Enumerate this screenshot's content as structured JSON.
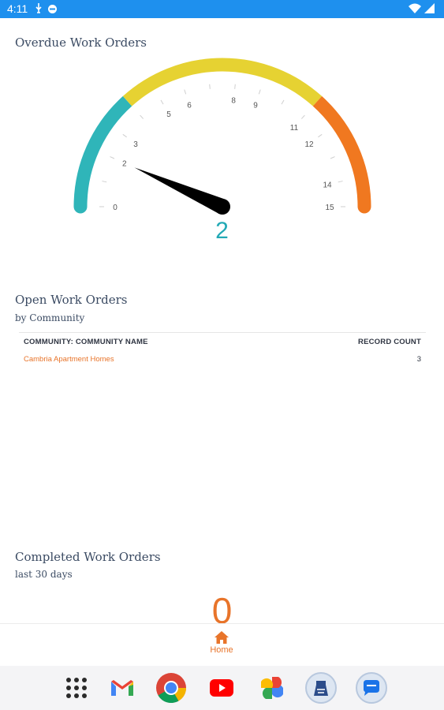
{
  "status_bar": {
    "time": "4:11",
    "left_icons": [
      "usb-icon",
      "sync-icon"
    ],
    "right_icons": [
      "wifi-icon",
      "signal-icon"
    ]
  },
  "overdue": {
    "title": "Overdue Work Orders",
    "value": "2",
    "gauge": {
      "min": 0,
      "max": 15,
      "value": 2,
      "tick_labels": [
        "0",
        "2",
        "3",
        "5",
        "6",
        "8",
        "9",
        "11",
        "12",
        "14",
        "15"
      ],
      "bands": [
        {
          "from": 0,
          "to": 4,
          "color": "#2fb5b9"
        },
        {
          "from": 4,
          "to": 11,
          "color": "#e6d232"
        },
        {
          "from": 11,
          "to": 15,
          "color": "#f07820"
        }
      ],
      "needle_color": "#000000",
      "value_color": "#22a9b5"
    }
  },
  "open": {
    "title": "Open Work Orders",
    "subtitle": "by Community",
    "columns": [
      "COMMUNITY: COMMUNITY NAME",
      "RECORD COUNT"
    ],
    "rows": [
      {
        "name": "Cambria Apartment Homes",
        "count": "3"
      }
    ]
  },
  "completed": {
    "title": "Completed Work Orders",
    "subtitle": "last 30 days",
    "value": "0"
  },
  "nav": {
    "home_label": "Home",
    "accent": "#e8742a"
  },
  "dock": {
    "apps": [
      "app-drawer-icon",
      "gmail-icon",
      "chrome-icon",
      "youtube-icon",
      "photos-icon",
      "app-icon",
      "messages-icon"
    ]
  }
}
